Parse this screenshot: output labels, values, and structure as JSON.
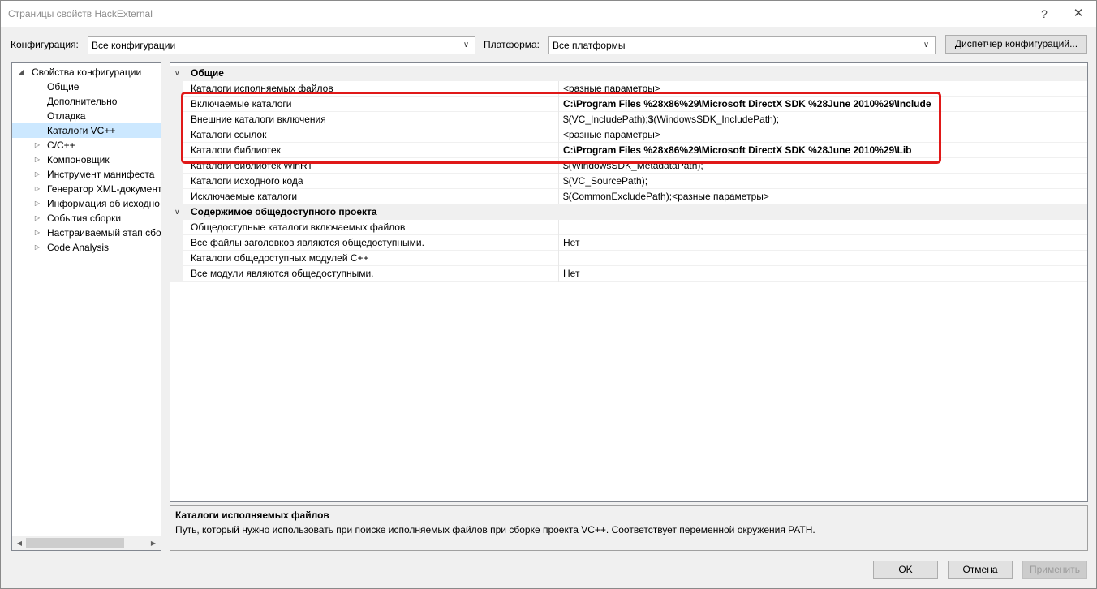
{
  "window": {
    "title": "Страницы свойств HackExternal",
    "help_glyph": "?",
    "close_glyph": "✕"
  },
  "toolbar": {
    "config_label": "Конфигурация:",
    "config_value": "Все конфигурации",
    "platform_label": "Платформа:",
    "platform_value": "Все платформы",
    "config_manager_button": "Диспетчер конфигураций..."
  },
  "tree": {
    "items": [
      {
        "label": "Свойства конфигурации",
        "level": 0,
        "expander": "◢",
        "selected": false
      },
      {
        "label": "Общие",
        "level": 1,
        "expander": "",
        "selected": false
      },
      {
        "label": "Дополнительно",
        "level": 1,
        "expander": "",
        "selected": false
      },
      {
        "label": "Отладка",
        "level": 1,
        "expander": "",
        "selected": false
      },
      {
        "label": "Каталоги VC++",
        "level": 1,
        "expander": "",
        "selected": true
      },
      {
        "label": "C/C++",
        "level": 1,
        "expander": "▷",
        "selected": false
      },
      {
        "label": "Компоновщик",
        "level": 1,
        "expander": "▷",
        "selected": false
      },
      {
        "label": "Инструмент манифеста",
        "level": 1,
        "expander": "▷",
        "selected": false
      },
      {
        "label": "Генератор XML-документ",
        "level": 1,
        "expander": "▷",
        "selected": false
      },
      {
        "label": "Информация об исходно",
        "level": 1,
        "expander": "▷",
        "selected": false
      },
      {
        "label": "События сборки",
        "level": 1,
        "expander": "▷",
        "selected": false
      },
      {
        "label": "Настраиваемый этап сбо",
        "level": 1,
        "expander": "▷",
        "selected": false
      },
      {
        "label": "Code Analysis",
        "level": 1,
        "expander": "▷",
        "selected": false
      }
    ]
  },
  "grid": {
    "rows": [
      {
        "type": "category",
        "name": "Общие"
      },
      {
        "type": "prop",
        "name": "Каталоги исполняемых файлов",
        "value": "<разные параметры>",
        "bold": false
      },
      {
        "type": "prop",
        "name": "Включаемые каталоги",
        "value": "C:\\Program Files %28x86%29\\Microsoft DirectX SDK %28June 2010%29\\Include",
        "bold": true
      },
      {
        "type": "prop",
        "name": "Внешние каталоги включения",
        "value": "$(VC_IncludePath);$(WindowsSDK_IncludePath);",
        "bold": false
      },
      {
        "type": "prop",
        "name": "Каталоги ссылок",
        "value": "<разные параметры>",
        "bold": false
      },
      {
        "type": "prop",
        "name": "Каталоги библиотек",
        "value": "C:\\Program Files %28x86%29\\Microsoft DirectX SDK %28June 2010%29\\Lib",
        "bold": true
      },
      {
        "type": "prop",
        "name": "Каталоги библиотек WinRT",
        "value": "$(WindowsSDK_MetadataPath);",
        "bold": false
      },
      {
        "type": "prop",
        "name": "Каталоги исходного кода",
        "value": "$(VC_SourcePath);",
        "bold": false
      },
      {
        "type": "prop",
        "name": "Исключаемые каталоги",
        "value": "$(CommonExcludePath);<разные параметры>",
        "bold": false
      },
      {
        "type": "category",
        "name": "Содержимое общедоступного проекта"
      },
      {
        "type": "prop",
        "name": "Общедоступные каталоги включаемых файлов",
        "value": "",
        "bold": false
      },
      {
        "type": "prop",
        "name": "Все файлы заголовков являются общедоступными.",
        "value": "Нет",
        "bold": false
      },
      {
        "type": "prop",
        "name": "Каталоги общедоступных модулей C++",
        "value": "",
        "bold": false
      },
      {
        "type": "prop",
        "name": "Все модули являются общедоступными.",
        "value": "Нет",
        "bold": false
      }
    ]
  },
  "description": {
    "title": "Каталоги исполняемых файлов",
    "text": "Путь, который нужно использовать при поиске исполняемых файлов при сборке проекта VC++.  Соответствует переменной окружения PATH."
  },
  "buttons": {
    "ok": "OK",
    "cancel": "Отмена",
    "apply": "Применить"
  },
  "colors": {
    "highlight_border": "#e01818",
    "tree_selected": "#cce8ff"
  }
}
